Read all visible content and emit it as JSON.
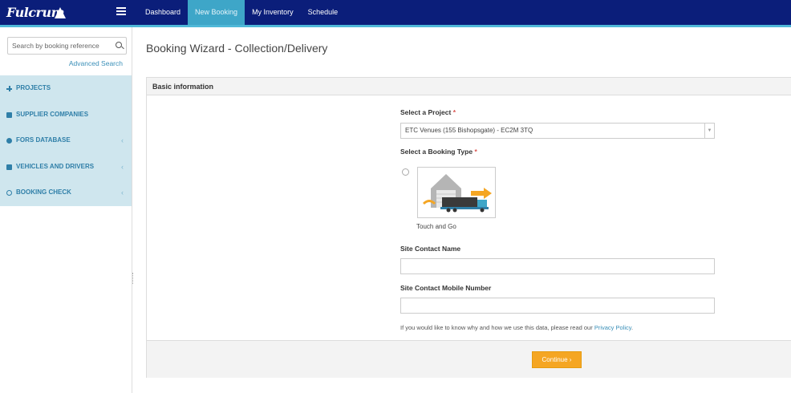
{
  "header": {
    "logo_text": "Fulcrum",
    "nav": [
      {
        "label": "Dashboard",
        "active": false
      },
      {
        "label": "New Booking",
        "active": true
      },
      {
        "label": "My Inventory",
        "active": false
      },
      {
        "label": "Schedule",
        "active": false
      }
    ],
    "colors": {
      "bar": "#0b1e7a",
      "accent": "#3ea6c8"
    }
  },
  "sidebar": {
    "search_placeholder": "Search by booking reference",
    "advanced_search": "Advanced Search",
    "items": [
      {
        "label": "PROJECTS",
        "icon": "projects-icon",
        "has_submenu": false
      },
      {
        "label": "SUPPLIER COMPANIES",
        "icon": "truck-icon",
        "has_submenu": false
      },
      {
        "label": "FORS DATABASE",
        "icon": "circle-icon",
        "has_submenu": true
      },
      {
        "label": "VEHICLES AND DRIVERS",
        "icon": "truck-icon",
        "has_submenu": true
      },
      {
        "label": "BOOKING CHECK",
        "icon": "clock-icon",
        "has_submenu": true
      }
    ],
    "submenu_glyph": "‹"
  },
  "main": {
    "title": "Booking Wizard - Collection/Delivery",
    "panel_title": "Basic information",
    "project_label": "Select a Project",
    "project_value": "ETC Venues (155 Bishopsgate) - EC2M 3TQ",
    "booking_type_label": "Select a Booking Type",
    "booking_type_option": "Touch and Go",
    "required_mark": "*",
    "contact_name_label": "Site Contact Name",
    "contact_mobile_label": "Site Contact Mobile Number",
    "privacy_text": "If you would like to know why and how we use this data, please read our ",
    "privacy_link": "Privacy Policy",
    "privacy_end": ".",
    "continue_label": "Continue ›"
  }
}
